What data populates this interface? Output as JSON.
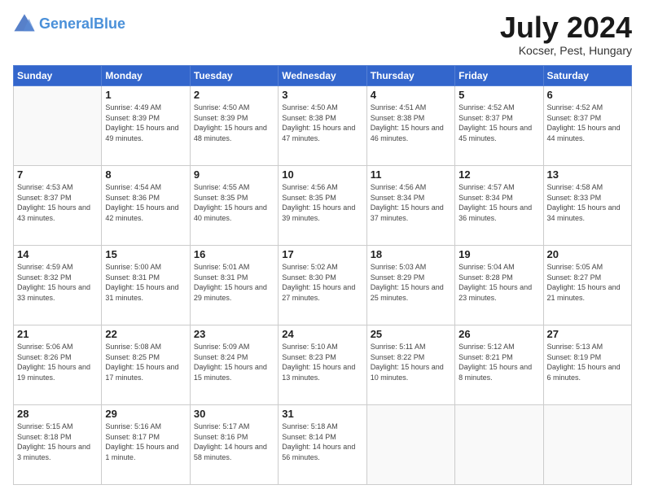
{
  "header": {
    "logo_line1": "General",
    "logo_line2": "Blue",
    "month_year": "July 2024",
    "location": "Kocser, Pest, Hungary"
  },
  "weekdays": [
    "Sunday",
    "Monday",
    "Tuesday",
    "Wednesday",
    "Thursday",
    "Friday",
    "Saturday"
  ],
  "weeks": [
    [
      {
        "day": "",
        "empty": true
      },
      {
        "day": "1",
        "sunrise": "4:49 AM",
        "sunset": "8:39 PM",
        "daylight": "15 hours and 49 minutes."
      },
      {
        "day": "2",
        "sunrise": "4:50 AM",
        "sunset": "8:39 PM",
        "daylight": "15 hours and 48 minutes."
      },
      {
        "day": "3",
        "sunrise": "4:50 AM",
        "sunset": "8:38 PM",
        "daylight": "15 hours and 47 minutes."
      },
      {
        "day": "4",
        "sunrise": "4:51 AM",
        "sunset": "8:38 PM",
        "daylight": "15 hours and 46 minutes."
      },
      {
        "day": "5",
        "sunrise": "4:52 AM",
        "sunset": "8:37 PM",
        "daylight": "15 hours and 45 minutes."
      },
      {
        "day": "6",
        "sunrise": "4:52 AM",
        "sunset": "8:37 PM",
        "daylight": "15 hours and 44 minutes."
      }
    ],
    [
      {
        "day": "7",
        "sunrise": "4:53 AM",
        "sunset": "8:37 PM",
        "daylight": "15 hours and 43 minutes."
      },
      {
        "day": "8",
        "sunrise": "4:54 AM",
        "sunset": "8:36 PM",
        "daylight": "15 hours and 42 minutes."
      },
      {
        "day": "9",
        "sunrise": "4:55 AM",
        "sunset": "8:35 PM",
        "daylight": "15 hours and 40 minutes."
      },
      {
        "day": "10",
        "sunrise": "4:56 AM",
        "sunset": "8:35 PM",
        "daylight": "15 hours and 39 minutes."
      },
      {
        "day": "11",
        "sunrise": "4:56 AM",
        "sunset": "8:34 PM",
        "daylight": "15 hours and 37 minutes."
      },
      {
        "day": "12",
        "sunrise": "4:57 AM",
        "sunset": "8:34 PM",
        "daylight": "15 hours and 36 minutes."
      },
      {
        "day": "13",
        "sunrise": "4:58 AM",
        "sunset": "8:33 PM",
        "daylight": "15 hours and 34 minutes."
      }
    ],
    [
      {
        "day": "14",
        "sunrise": "4:59 AM",
        "sunset": "8:32 PM",
        "daylight": "15 hours and 33 minutes."
      },
      {
        "day": "15",
        "sunrise": "5:00 AM",
        "sunset": "8:31 PM",
        "daylight": "15 hours and 31 minutes."
      },
      {
        "day": "16",
        "sunrise": "5:01 AM",
        "sunset": "8:31 PM",
        "daylight": "15 hours and 29 minutes."
      },
      {
        "day": "17",
        "sunrise": "5:02 AM",
        "sunset": "8:30 PM",
        "daylight": "15 hours and 27 minutes."
      },
      {
        "day": "18",
        "sunrise": "5:03 AM",
        "sunset": "8:29 PM",
        "daylight": "15 hours and 25 minutes."
      },
      {
        "day": "19",
        "sunrise": "5:04 AM",
        "sunset": "8:28 PM",
        "daylight": "15 hours and 23 minutes."
      },
      {
        "day": "20",
        "sunrise": "5:05 AM",
        "sunset": "8:27 PM",
        "daylight": "15 hours and 21 minutes."
      }
    ],
    [
      {
        "day": "21",
        "sunrise": "5:06 AM",
        "sunset": "8:26 PM",
        "daylight": "15 hours and 19 minutes."
      },
      {
        "day": "22",
        "sunrise": "5:08 AM",
        "sunset": "8:25 PM",
        "daylight": "15 hours and 17 minutes."
      },
      {
        "day": "23",
        "sunrise": "5:09 AM",
        "sunset": "8:24 PM",
        "daylight": "15 hours and 15 minutes."
      },
      {
        "day": "24",
        "sunrise": "5:10 AM",
        "sunset": "8:23 PM",
        "daylight": "15 hours and 13 minutes."
      },
      {
        "day": "25",
        "sunrise": "5:11 AM",
        "sunset": "8:22 PM",
        "daylight": "15 hours and 10 minutes."
      },
      {
        "day": "26",
        "sunrise": "5:12 AM",
        "sunset": "8:21 PM",
        "daylight": "15 hours and 8 minutes."
      },
      {
        "day": "27",
        "sunrise": "5:13 AM",
        "sunset": "8:19 PM",
        "daylight": "15 hours and 6 minutes."
      }
    ],
    [
      {
        "day": "28",
        "sunrise": "5:15 AM",
        "sunset": "8:18 PM",
        "daylight": "15 hours and 3 minutes."
      },
      {
        "day": "29",
        "sunrise": "5:16 AM",
        "sunset": "8:17 PM",
        "daylight": "15 hours and 1 minute."
      },
      {
        "day": "30",
        "sunrise": "5:17 AM",
        "sunset": "8:16 PM",
        "daylight": "14 hours and 58 minutes."
      },
      {
        "day": "31",
        "sunrise": "5:18 AM",
        "sunset": "8:14 PM",
        "daylight": "14 hours and 56 minutes."
      },
      {
        "day": "",
        "empty": true
      },
      {
        "day": "",
        "empty": true
      },
      {
        "day": "",
        "empty": true
      }
    ]
  ]
}
